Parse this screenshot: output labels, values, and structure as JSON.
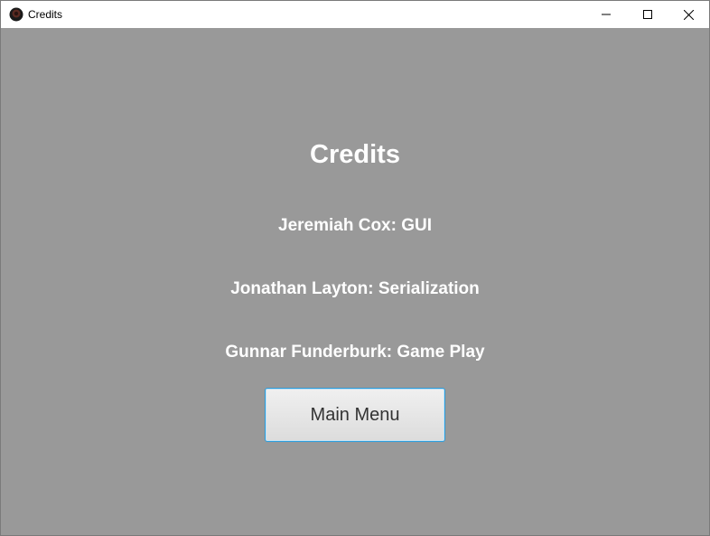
{
  "window": {
    "title": "Credits"
  },
  "credits": {
    "heading": "Credits",
    "lines": [
      "Jeremiah Cox: GUI",
      "Jonathan Layton: Serialization",
      "Gunnar Funderburk: Game Play"
    ]
  },
  "actions": {
    "main_menu_label": "Main Menu"
  },
  "colors": {
    "background": "#999999",
    "text": "#ffffff",
    "button_focus_border": "#2b9ad9"
  },
  "icons": {
    "app": "app-icon",
    "minimize": "minimize-icon",
    "maximize": "maximize-icon",
    "close": "close-icon"
  }
}
